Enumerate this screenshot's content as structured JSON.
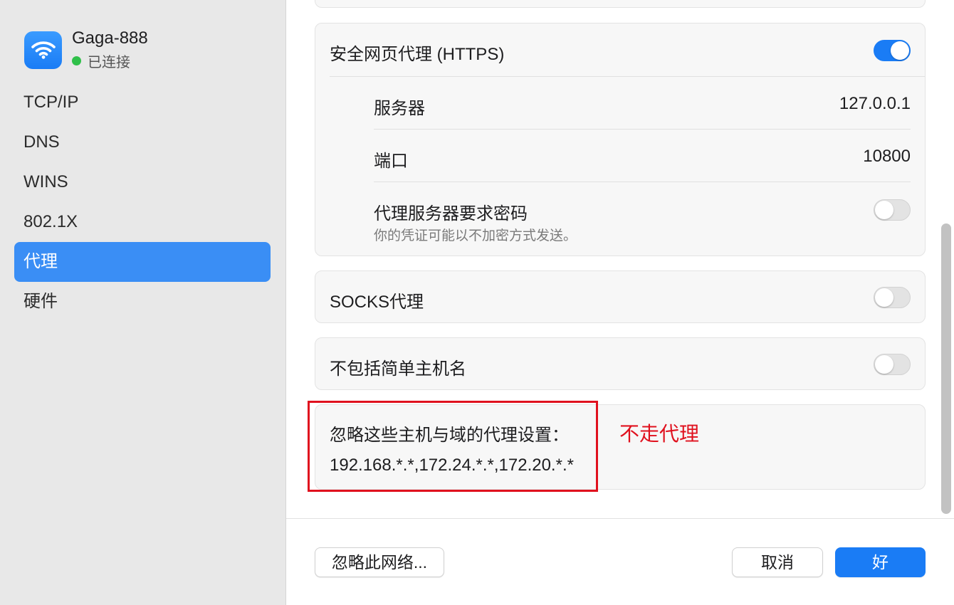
{
  "network": {
    "name": "Gaga-888",
    "status": "已连接",
    "icon": "wifi-icon",
    "status_color": "#30c04a"
  },
  "sidebar": {
    "items": [
      {
        "label": "TCP/IP",
        "active": false
      },
      {
        "label": "DNS",
        "active": false
      },
      {
        "label": "WINS",
        "active": false
      },
      {
        "label": "802.1X",
        "active": false
      },
      {
        "label": "代理",
        "active": true
      },
      {
        "label": "硬件",
        "active": false
      }
    ]
  },
  "https_proxy": {
    "title": "安全网页代理 (HTTPS)",
    "enabled": true,
    "server_label": "服务器",
    "server_value": "127.0.0.1",
    "port_label": "端口",
    "port_value": "10800",
    "password_label": "代理服务器要求密码",
    "password_note": "你的凭证可能以不加密方式发送。",
    "password_enabled": false
  },
  "socks_proxy": {
    "title": "SOCKS代理",
    "enabled": false
  },
  "exclude_simple": {
    "title": "不包括简单主机名",
    "enabled": false
  },
  "bypass": {
    "label": "忽略这些主机与域的代理设置：",
    "value": "192.168.*.*,172.24.*.*,172.20.*.*"
  },
  "annotation": {
    "text": "不走代理",
    "color": "#e0111e"
  },
  "footer": {
    "forget_label": "忽略此网络...",
    "cancel_label": "取消",
    "ok_label": "好"
  },
  "colors": {
    "accent": "#1a7cf5",
    "sidebar_selected": "#3a8ef5"
  }
}
